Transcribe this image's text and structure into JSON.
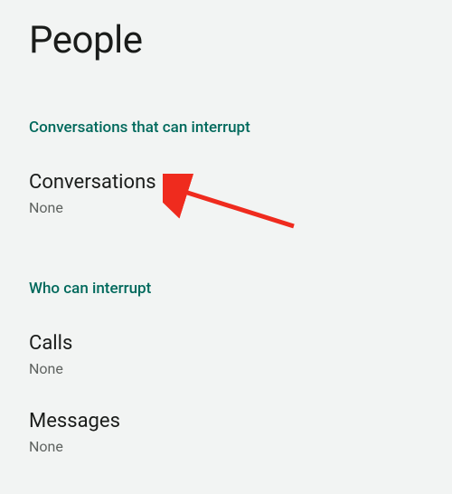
{
  "pageTitle": "People",
  "section1": {
    "header": "Conversations that can interrupt",
    "items": [
      {
        "label": "Conversations",
        "value": "None"
      }
    ]
  },
  "section2": {
    "header": "Who can interrupt",
    "items": [
      {
        "label": "Calls",
        "value": "None"
      },
      {
        "label": "Messages",
        "value": "None"
      }
    ]
  }
}
